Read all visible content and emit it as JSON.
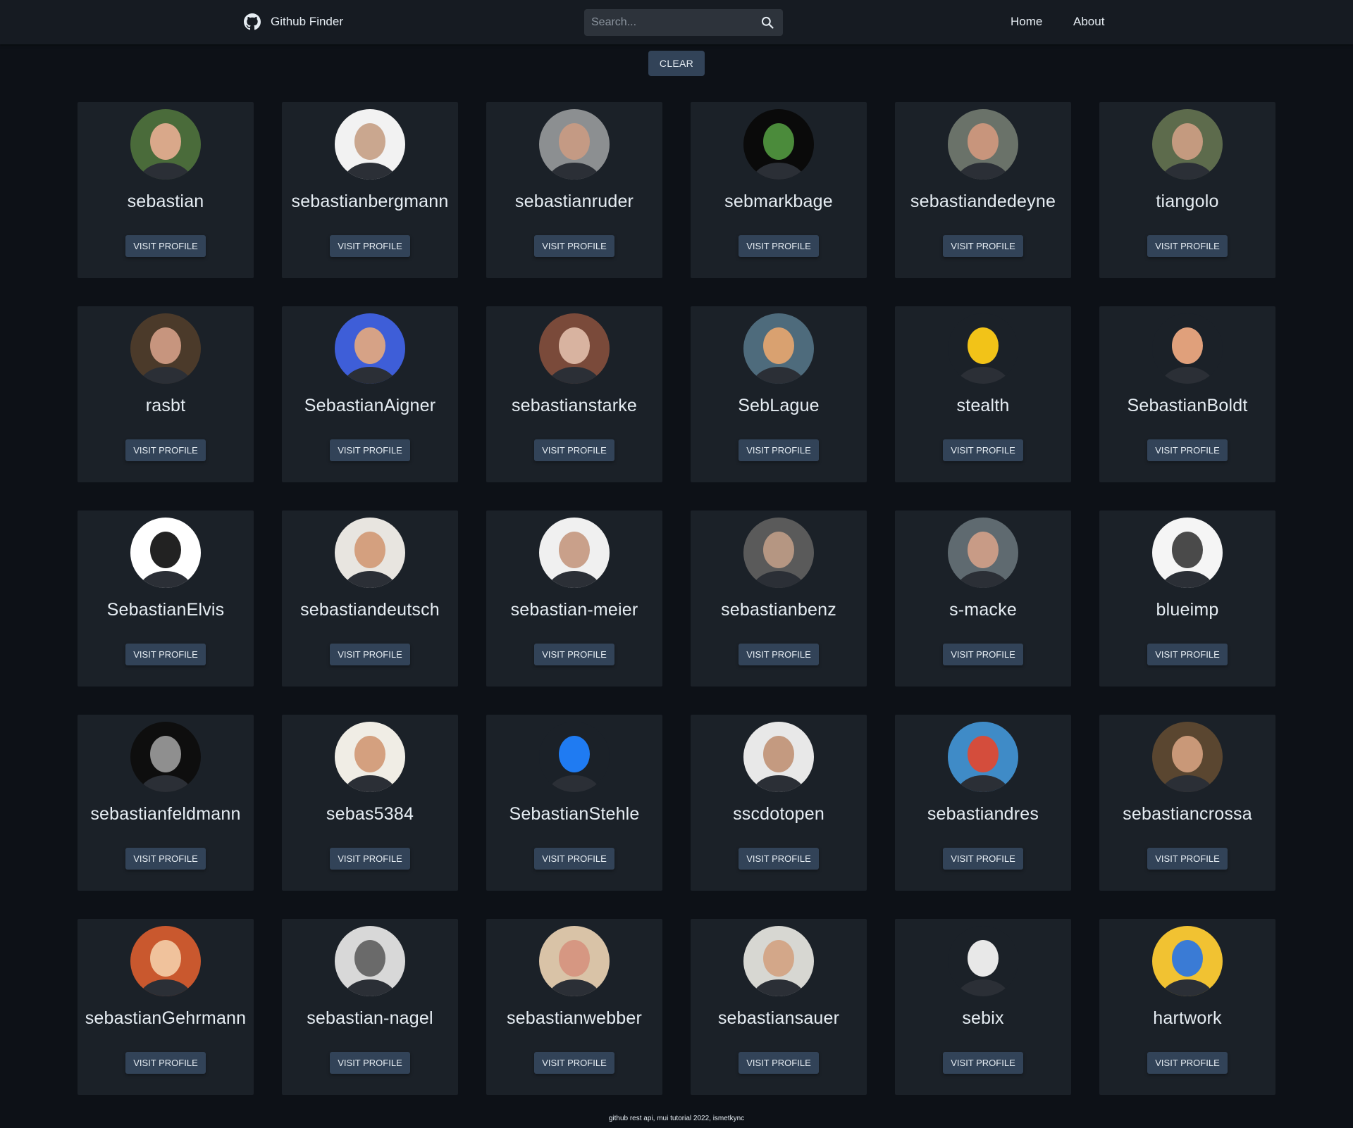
{
  "navbar": {
    "brand": "Github Finder",
    "brand_icon": "github-icon",
    "search_placeholder": "Search...",
    "search_icon": "search-icon",
    "links": {
      "home": "Home",
      "about": "About"
    }
  },
  "clear_button": "CLEAR",
  "visit_label": "VISIT PROFILE",
  "users": [
    {
      "login": "sebastian",
      "bg": "#4a6b3a",
      "fg": "#d9a88a"
    },
    {
      "login": "sebastianbergmann",
      "bg": "#f2f2f2",
      "fg": "#caa78f"
    },
    {
      "login": "sebastianruder",
      "bg": "#8c8f91",
      "fg": "#c49a84"
    },
    {
      "login": "sebmarkbage",
      "bg": "#0a0a0a",
      "fg": "#4b8b3b"
    },
    {
      "login": "sebastiandedeyne",
      "bg": "#6a7269",
      "fg": "#c8957c"
    },
    {
      "login": "tiangolo",
      "bg": "#5d6b4c",
      "fg": "#c49a7f"
    },
    {
      "login": "rasbt",
      "bg": "#4b3a2a",
      "fg": "#c7957e"
    },
    {
      "login": "SebastianAigner",
      "bg": "#3e5ed8",
      "fg": "#d6a286"
    },
    {
      "login": "sebastianstarke",
      "bg": "#7a4a3a",
      "fg": "#d8b3a0"
    },
    {
      "login": "SebLague",
      "bg": "#4e6b7c",
      "fg": "#d9a170"
    },
    {
      "login": "stealth",
      "bg": "#1b2128",
      "fg": "#f2c318"
    },
    {
      "login": "SebastianBoldt",
      "bg": "#1b2128",
      "fg": "#e0a07b"
    },
    {
      "login": "SebastianElvis",
      "bg": "#ffffff",
      "fg": "#222222"
    },
    {
      "login": "sebastiandeutsch",
      "bg": "#e8e5e0",
      "fg": "#d4a07f"
    },
    {
      "login": "sebastian-meier",
      "bg": "#f0f0f0",
      "fg": "#c9a08a"
    },
    {
      "login": "sebastianbenz",
      "bg": "#5a5a5a",
      "fg": "#b59682"
    },
    {
      "login": "s-macke",
      "bg": "#5f6a70",
      "fg": "#c89b86"
    },
    {
      "login": "blueimp",
      "bg": "#f5f5f5",
      "fg": "#4a4a4a"
    },
    {
      "login": "sebastianfeldmann",
      "bg": "#0e0e0e",
      "fg": "#8f8f8f"
    },
    {
      "login": "sebas5384",
      "bg": "#f0ede5",
      "fg": "#d4a07f"
    },
    {
      "login": "SebastianStehle",
      "bg": "#1b2128",
      "fg": "#1f7bf2"
    },
    {
      "login": "sscdotopen",
      "bg": "#e8e8e8",
      "fg": "#c49a80"
    },
    {
      "login": "sebastiandres",
      "bg": "#3f8bc7",
      "fg": "#d44d3c"
    },
    {
      "login": "sebastiancrossa",
      "bg": "#5a4630",
      "fg": "#c99878"
    },
    {
      "login": "sebastianGehrmann",
      "bg": "#c9582e",
      "fg": "#f0c29c"
    },
    {
      "login": "sebastian-nagel",
      "bg": "#d8d8d8",
      "fg": "#6a6a6a"
    },
    {
      "login": "sebastianwebber",
      "bg": "#d9c3a7",
      "fg": "#d69782"
    },
    {
      "login": "sebastiansauer",
      "bg": "#d7d7d2",
      "fg": "#d3a789"
    },
    {
      "login": "sebix",
      "bg": "#1b2128",
      "fg": "#e8e8e8"
    },
    {
      "login": "hartwork",
      "bg": "#f1c232",
      "fg": "#3a7bd5"
    }
  ],
  "footer": "github rest api, mui tutorial 2022, ismetkync"
}
